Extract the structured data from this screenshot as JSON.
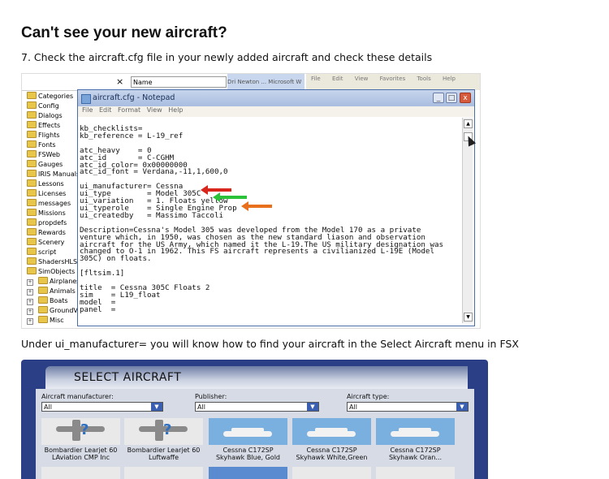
{
  "heading": "Can't see your new aircraft?",
  "step7": "7. Check the aircraft.cfg file in your newly added aircraft and check these details",
  "under_text": "Under ui_manufacturer= you will know how to find your aircraft in the Select Aircraft menu in FSX",
  "explorer": {
    "close_glyph": "×",
    "name_header": "Name",
    "strip_text": "Dri Newton ... Microsoft W",
    "menu_right": [
      "File",
      "Edit",
      "View",
      "Favorites",
      "Tools",
      "Help"
    ],
    "tree": [
      {
        "label": "Categories"
      },
      {
        "label": "Config"
      },
      {
        "label": "Dialogs"
      },
      {
        "label": "Effects"
      },
      {
        "label": "Flights"
      },
      {
        "label": "Fonts"
      },
      {
        "label": "FSWeb"
      },
      {
        "label": "Gauges"
      },
      {
        "label": "IRIS Manuals"
      },
      {
        "label": "Lessons"
      },
      {
        "label": "Licenses"
      },
      {
        "label": "messages"
      },
      {
        "label": "Missions"
      },
      {
        "label": "propdefs"
      },
      {
        "label": "Rewards"
      },
      {
        "label": "Scenery"
      },
      {
        "label": "script"
      },
      {
        "label": "ShadersHLSL"
      },
      {
        "label": "SimObjects"
      },
      {
        "label": "Airplanes"
      },
      {
        "label": "Animals"
      },
      {
        "label": "Boats"
      },
      {
        "label": "GroundVe"
      },
      {
        "label": "Misc"
      }
    ]
  },
  "notepad": {
    "title": "aircraft.cfg - Notepad",
    "menu": [
      "File",
      "Edit",
      "Format",
      "View",
      "Help"
    ],
    "min": "_",
    "max": "□",
    "close": "x",
    "content": "kb_checklists=\nkb_reference = L-19_ref\n\natc_heavy    = 0\natc_id       = C-CGHM\natc_id_color= 0x00000000\natc_id_font = Verdana,-11,1,600,0\n\nui_manufacturer= Cessna\nui_type        = Model 305C\nui_variation   = 1. Floats yellow\nui_typerole    = Single Engine Prop\nui_createdby   = Massimo Taccoli\n\nDescription=Cessna's Model 305 was developed from the Model 170 as a private\nventure which, in 1950, was chosen as the new standard liason and observation\naircraft for the US Army, which named it the L-19.The US military designation was\nchanged to O-1 in 1962. This FS aircraft represents a civilianized L-19E (Model\n305C) on floats.\n\n[fltsim.1]\n\ntitle  = Cessna 305C Floats 2\nsim    = L19_float\nmodel  =\npanel  ="
  },
  "arrows": {
    "red": "#d8261c",
    "green": "#2bc23a",
    "orange": "#e8701c"
  },
  "fsx": {
    "title": "SELECT AIRCRAFT",
    "manufacturer_label": "Aircraft manufacturer:",
    "manufacturer_value": "All",
    "publisher_label": "Publisher:",
    "publisher_value": "All",
    "type_label": "Aircraft type:",
    "type_value": "All",
    "dropdown_glyph": "▼",
    "tiles": [
      {
        "line1": "Bombardier Learjet 60",
        "line2": "LAviation CMP Inc"
      },
      {
        "line1": "Bombardier Learjet 60",
        "line2": "Luftwaffe"
      },
      {
        "line1": "Cessna C172SP",
        "line2": "Skyhawk  Blue, Gold"
      },
      {
        "line1": "Cessna C172SP",
        "line2": "Skyhawk  White,Green"
      },
      {
        "line1": "Cessna C172SP",
        "line2": "Skyhawk  Oran..."
      }
    ]
  }
}
